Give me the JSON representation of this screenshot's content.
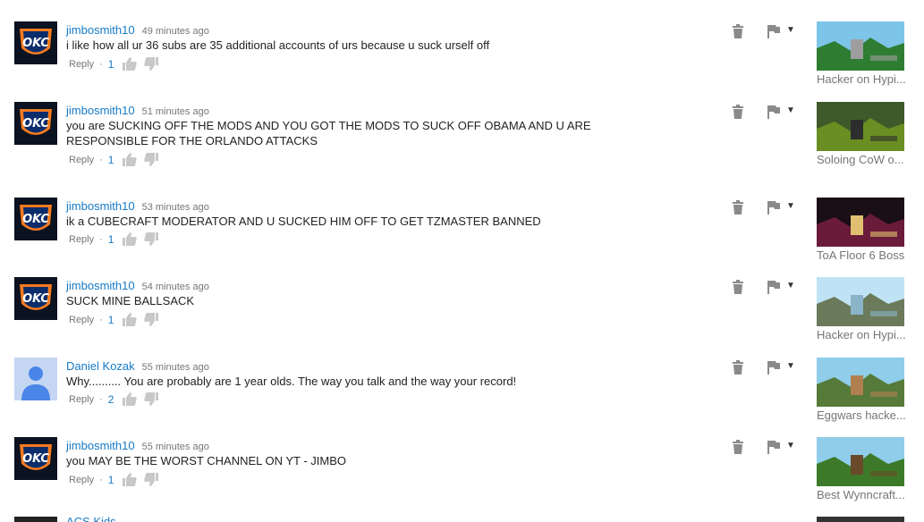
{
  "comments": [
    {
      "author": "jimbosmith10",
      "time": "49 minutes ago",
      "text": "i like how all ur 36 subs are 35 additional accounts of urs because u suck urself off",
      "reply": "Reply",
      "dot": "·",
      "likes": "1",
      "avatar": "okc-logo-icon",
      "video_title": "Hacker on Hypixel",
      "video_title_display": "Hacker on Hypi..."
    },
    {
      "author": "jimbosmith10",
      "time": "51 minutes ago",
      "text": "you are SUCKING OFF THE MODS AND YOU GOT THE MODS TO SUCK OFF OBAMA AND U ARE RESPONSIBLE FOR THE ORLANDO ATTACKS",
      "reply": "Reply",
      "dot": "·",
      "likes": "1",
      "avatar": "okc-logo-icon",
      "video_title_display": "Soloing CoW o..."
    },
    {
      "author": "jimbosmith10",
      "time": "53 minutes ago",
      "text": "ik a CUBECRAFT MODERATOR AND U SUCKED HIM OFF TO GET TZMASTER BANNED",
      "reply": "Reply",
      "dot": "·",
      "likes": "1",
      "avatar": "okc-logo-icon",
      "video_title_display": "ToA Floor 6 Boss"
    },
    {
      "author": "jimbosmith10",
      "time": "54 minutes ago",
      "text": "SUCK MINE BALLSACK",
      "reply": "Reply",
      "dot": "·",
      "likes": "1",
      "avatar": "okc-logo-icon",
      "video_title_display": "Hacker on Hypi..."
    },
    {
      "author": "Daniel Kozak",
      "time": "55 minutes ago",
      "text": "Why.......... You are probably are 1 year olds. The way you talk and the way your record!",
      "reply": "Reply",
      "dot": "·",
      "likes": "2",
      "avatar": "default-user-icon",
      "video_title_display": "Eggwars hacke..."
    },
    {
      "author": "jimbosmith10",
      "time": "55 minutes ago",
      "text": "you MAY BE THE WORST CHANNEL ON YT - JIMBO",
      "reply": "Reply",
      "dot": "·",
      "likes": "1",
      "avatar": "okc-logo-icon",
      "video_title_display": "Best Wynncraft..."
    }
  ],
  "partial": {
    "author": "ACS Kids"
  },
  "icons": {
    "trash": "trash-icon",
    "flag": "flag-icon",
    "caret": "▼",
    "like": "thumbs-up-icon",
    "dislike": "thumbs-down-icon"
  },
  "colors": {
    "link": "#167ac6",
    "meta": "#767676",
    "text": "#222222",
    "icon": "#8a8a8a"
  }
}
